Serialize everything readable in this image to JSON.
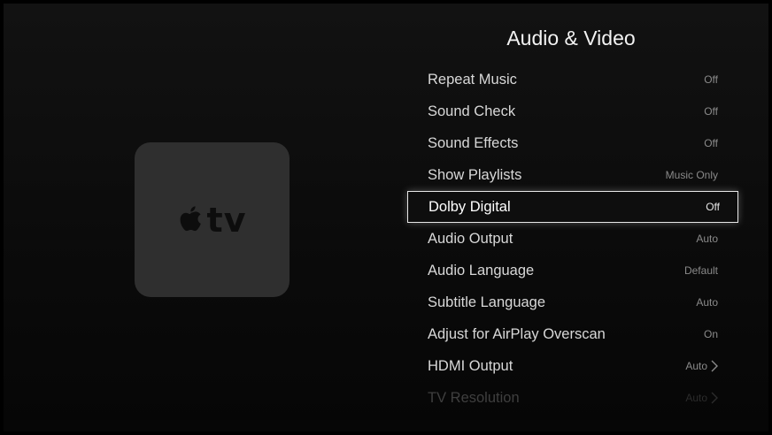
{
  "logo": {
    "text": "tv",
    "icon": "apple-logo"
  },
  "page": {
    "title": "Audio & Video"
  },
  "menu": {
    "items": [
      {
        "label": "Repeat Music",
        "value": "Off"
      },
      {
        "label": "Sound Check",
        "value": "Off"
      },
      {
        "label": "Sound Effects",
        "value": "Off"
      },
      {
        "label": "Show Playlists",
        "value": "Music Only"
      },
      {
        "label": "Dolby Digital",
        "value": "Off",
        "focused": true
      },
      {
        "label": "Audio Output",
        "value": "Auto"
      },
      {
        "label": "Audio Language",
        "value": "Default"
      },
      {
        "label": "Subtitle Language",
        "value": "Auto"
      },
      {
        "label": "Adjust for AirPlay Overscan",
        "value": "On"
      },
      {
        "label": "HDMI Output",
        "value": "Auto",
        "icon": "chevron-right"
      },
      {
        "label": "TV Resolution",
        "value": "Auto",
        "icon": "chevron-right"
      }
    ]
  },
  "colors": {
    "background": "#0b0b0b",
    "tile": "#2f2f2f",
    "focus_border": "#e8e8e8",
    "text": "#d8d8d8",
    "value_text": "#8a8a8a"
  }
}
